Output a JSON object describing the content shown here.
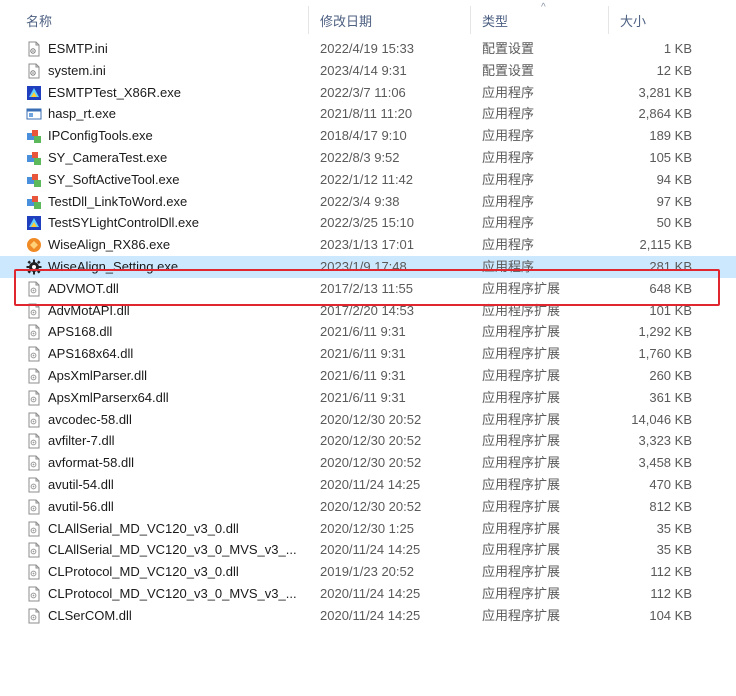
{
  "header": {
    "name": "名称",
    "date": "修改日期",
    "type": "类型",
    "size": "大小",
    "sort_glyph": "^"
  },
  "colors": {
    "selection": "#cce8ff",
    "highlight_border": "#e0262f",
    "header_text": "#4d6082"
  },
  "files": [
    {
      "name": "ESMTP.ini",
      "date": "2022/4/19 15:33",
      "type": "配置设置",
      "size": "1 KB",
      "icon": "ini-file-icon"
    },
    {
      "name": "system.ini",
      "date": "2023/4/14 9:31",
      "type": "配置设置",
      "size": "12 KB",
      "icon": "ini-file-icon"
    },
    {
      "name": "ESMTPTest_X86R.exe",
      "date": "2022/3/7 11:06",
      "type": "应用程序",
      "size": "3,281 KB",
      "icon": "app-blue-icon"
    },
    {
      "name": "hasp_rt.exe",
      "date": "2021/8/11 11:20",
      "type": "应用程序",
      "size": "2,864 KB",
      "icon": "window-app-icon"
    },
    {
      "name": "IPConfigTools.exe",
      "date": "2018/4/17 9:10",
      "type": "应用程序",
      "size": "189 KB",
      "icon": "app-generic-icon"
    },
    {
      "name": "SY_CameraTest.exe",
      "date": "2022/8/3 9:52",
      "type": "应用程序",
      "size": "105 KB",
      "icon": "app-generic-icon"
    },
    {
      "name": "SY_SoftActiveTool.exe",
      "date": "2022/1/12 11:42",
      "type": "应用程序",
      "size": "94 KB",
      "icon": "app-generic-icon"
    },
    {
      "name": "TestDll_LinkToWord.exe",
      "date": "2022/3/4 9:38",
      "type": "应用程序",
      "size": "97 KB",
      "icon": "app-generic-icon"
    },
    {
      "name": "TestSYLightControlDll.exe",
      "date": "2022/3/25 15:10",
      "type": "应用程序",
      "size": "50 KB",
      "icon": "app-blue-icon"
    },
    {
      "name": "WiseAlign_RX86.exe",
      "date": "2023/1/13 17:01",
      "type": "应用程序",
      "size": "2,115 KB",
      "icon": "app-orange-icon"
    },
    {
      "name": "WiseAlign_Setting.exe",
      "date": "2023/1/9 17:48",
      "type": "应用程序",
      "size": "281 KB",
      "icon": "gear-icon",
      "selected": true
    },
    {
      "name": "ADVMOT.dll",
      "date": "2017/2/13 11:55",
      "type": "应用程序扩展",
      "size": "648 KB",
      "icon": "dll-file-icon"
    },
    {
      "name": "AdvMotAPI.dll",
      "date": "2017/2/20 14:53",
      "type": "应用程序扩展",
      "size": "101 KB",
      "icon": "dll-file-icon"
    },
    {
      "name": "APS168.dll",
      "date": "2021/6/11 9:31",
      "type": "应用程序扩展",
      "size": "1,292 KB",
      "icon": "dll-file-icon"
    },
    {
      "name": "APS168x64.dll",
      "date": "2021/6/11 9:31",
      "type": "应用程序扩展",
      "size": "1,760 KB",
      "icon": "dll-file-icon"
    },
    {
      "name": "ApsXmlParser.dll",
      "date": "2021/6/11 9:31",
      "type": "应用程序扩展",
      "size": "260 KB",
      "icon": "dll-file-icon"
    },
    {
      "name": "ApsXmlParserx64.dll",
      "date": "2021/6/11 9:31",
      "type": "应用程序扩展",
      "size": "361 KB",
      "icon": "dll-file-icon"
    },
    {
      "name": "avcodec-58.dll",
      "date": "2020/12/30 20:52",
      "type": "应用程序扩展",
      "size": "14,046 KB",
      "icon": "dll-file-icon"
    },
    {
      "name": "avfilter-7.dll",
      "date": "2020/12/30 20:52",
      "type": "应用程序扩展",
      "size": "3,323 KB",
      "icon": "dll-file-icon"
    },
    {
      "name": "avformat-58.dll",
      "date": "2020/12/30 20:52",
      "type": "应用程序扩展",
      "size": "3,458 KB",
      "icon": "dll-file-icon"
    },
    {
      "name": "avutil-54.dll",
      "date": "2020/11/24 14:25",
      "type": "应用程序扩展",
      "size": "470 KB",
      "icon": "dll-file-icon"
    },
    {
      "name": "avutil-56.dll",
      "date": "2020/12/30 20:52",
      "type": "应用程序扩展",
      "size": "812 KB",
      "icon": "dll-file-icon"
    },
    {
      "name": "CLAllSerial_MD_VC120_v3_0.dll",
      "date": "2020/12/30 1:25",
      "type": "应用程序扩展",
      "size": "35 KB",
      "icon": "dll-file-icon"
    },
    {
      "name": "CLAllSerial_MD_VC120_v3_0_MVS_v3_...",
      "date": "2020/11/24 14:25",
      "type": "应用程序扩展",
      "size": "35 KB",
      "icon": "dll-file-icon"
    },
    {
      "name": "CLProtocol_MD_VC120_v3_0.dll",
      "date": "2019/1/23 20:52",
      "type": "应用程序扩展",
      "size": "112 KB",
      "icon": "dll-file-icon"
    },
    {
      "name": "CLProtocol_MD_VC120_v3_0_MVS_v3_...",
      "date": "2020/11/24 14:25",
      "type": "应用程序扩展",
      "size": "112 KB",
      "icon": "dll-file-icon"
    },
    {
      "name": "CLSerCOM.dll",
      "date": "2020/11/24 14:25",
      "type": "应用程序扩展",
      "size": "104 KB",
      "icon": "dll-file-icon"
    }
  ]
}
